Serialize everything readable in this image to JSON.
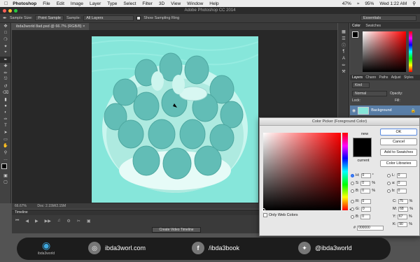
{
  "menubar": {
    "app": "Photoshop",
    "items": [
      "File",
      "Edit",
      "Image",
      "Layer",
      "Type",
      "Select",
      "Filter",
      "3D",
      "View",
      "Window",
      "Help"
    ],
    "battery": "47%",
    "battery2": "95%",
    "clock": "Wed 1:22 AM"
  },
  "window": {
    "title": "Adobe Photoshop CC 2014"
  },
  "options": {
    "sample_size_label": "Sample Size:",
    "sample_size_value": "Point Sample",
    "sample_label": "Sample:",
    "sample_value": "All Layers",
    "show_ring": "Show Sampling Ring",
    "workspace": "Essentials"
  },
  "document": {
    "tab": "ibda3world 8ad.psd @ 66.7% (RGB/8)",
    "zoom": "66.67%",
    "doc_info": "Doc: 2.15M/2.15M"
  },
  "timeline": {
    "label": "Timeline",
    "create": "Create Video Timeline"
  },
  "panels": {
    "color_tabs": [
      "Color",
      "Swatches"
    ],
    "layer_tabs": [
      "Layers",
      "Chann",
      "Paths",
      "Adjust",
      "Styles"
    ],
    "kind": "Kind",
    "blend": "Normal",
    "opacity_label": "Opacity:",
    "lock_label": "Lock:",
    "fill_label": "Fill:",
    "layer_name": "Background"
  },
  "dialog": {
    "title": "Color Picker (Foreground Color)",
    "new_label": "new",
    "current_label": "current",
    "ok": "OK",
    "cancel": "Cancel",
    "add_swatches": "Add to Swatches",
    "color_libraries": "Color Libraries",
    "only_web": "Only Web Colors",
    "hsb": [
      {
        "k": "H:",
        "v": "0",
        "u": "°"
      },
      {
        "k": "S:",
        "v": "0",
        "u": "%"
      },
      {
        "k": "B:",
        "v": "0",
        "u": "%"
      }
    ],
    "rgb": [
      {
        "k": "R:",
        "v": "0"
      },
      {
        "k": "G:",
        "v": "0"
      },
      {
        "k": "B:",
        "v": "0"
      }
    ],
    "lab": [
      {
        "k": "L:",
        "v": "0"
      },
      {
        "k": "a:",
        "v": "0"
      },
      {
        "k": "b:",
        "v": "0"
      }
    ],
    "cmyk": [
      {
        "k": "C:",
        "v": "75",
        "u": "%"
      },
      {
        "k": "M:",
        "v": "68",
        "u": "%"
      },
      {
        "k": "Y:",
        "v": "67",
        "u": "%"
      },
      {
        "k": "K:",
        "v": "90",
        "u": "%"
      }
    ],
    "hex_label": "#",
    "hex": "000000"
  },
  "banner": {
    "site": "ibda3worl.com",
    "facebook": "/ibda3book",
    "twitter": "@ibda3world",
    "logo_text": "ibda3world"
  }
}
